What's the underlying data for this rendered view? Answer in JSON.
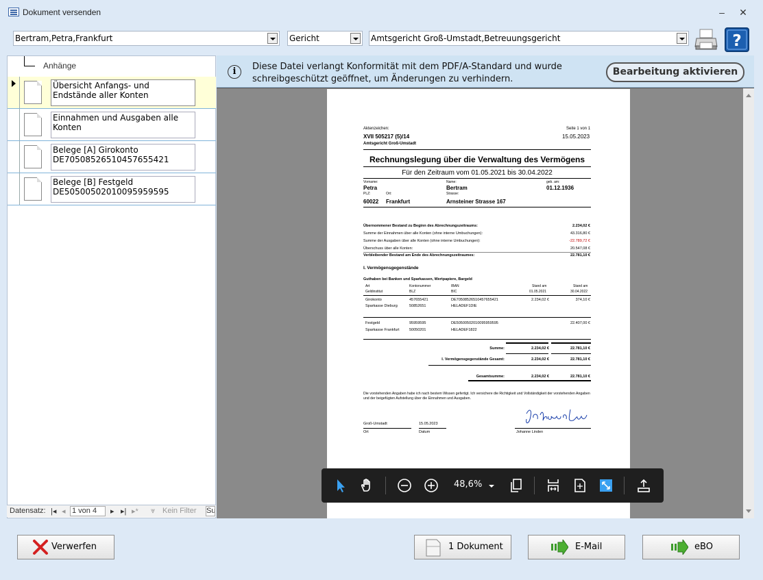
{
  "window": {
    "title": "Dokument versenden",
    "minimize": "–",
    "close": "✕"
  },
  "filters": {
    "person": "Bertram,Petra,Frankfurt",
    "recipient_type": "Gericht",
    "recipient": "Amtsgericht Groß-Umstadt,Betreuungsgericht"
  },
  "tree": {
    "root_label": "Anhänge"
  },
  "attachments": [
    {
      "label": "Übersicht Anfangs- und Endstände aller Konten"
    },
    {
      "label": "Einnahmen und Ausgaben alle Konten"
    },
    {
      "label": "Belege [A] Girokonto DE70508526510457655421"
    },
    {
      "label": "Belege [B] Festgeld DE50500502010095959595"
    }
  ],
  "record_nav": {
    "label": "Datensatz:",
    "position": "1 von 4",
    "filter": "Kein Filter",
    "search": "Su"
  },
  "infobar": {
    "message": "Diese Datei verlangt Konformität mit dem PDF/A-Standard und wurde schreibgeschützt geöffnet, um Änderungen zu verhindern.",
    "button": "Bearbeitung aktivieren"
  },
  "pdf": {
    "az_label": "Aktenzeichen:",
    "az": "XVII 505217 (5)/14",
    "court": "Amtsgericht Groß-Umstadt",
    "page": "Seite 1 von 1",
    "date": "15.05.2023",
    "title": "Rechnungslegung über die Verwaltung des Vermögens",
    "period": "Für den Zeitraum vom 01.05.2021 bis 30.04.2022",
    "vorname_label": "Vorname:",
    "vorname": "Petra",
    "name_label": "Name:",
    "name": "Bertram",
    "geb_label": "geb. am:",
    "geb": "01.12.1936",
    "plz_label": "PLZ:",
    "ort_label": "Ort:",
    "strasse_label": "Strasse:",
    "plz": "60022",
    "ort": "Frankfurt",
    "strasse": "Arnsteiner Strasse 167",
    "summary": [
      {
        "label": "Übernommener Bestand zu Beginn des Abrechnungszeitraums:",
        "value": "2.234,02 €",
        "bold": true
      },
      {
        "label": "Summe der Einnahmen über alle Konten (ohne interne Umbuchungen):",
        "value": "43.316,80 €"
      },
      {
        "label": "Summe der Ausgaben über alle Konten (ohne interne Umbuchungen):",
        "value": "-22.789,72 €",
        "red": true
      },
      {
        "label": "Überschuss über alle Konten:",
        "value": "20.547,08 €"
      },
      {
        "label": "Verbleibender Bestand am Ende des Abrechnungszeitraumes:",
        "value": "22.781,10 €",
        "bold": true
      }
    ],
    "section1": "I. Vermögensgegenstände",
    "subsection": "Guthaben bei Banken und Sparkassen, Wertpapiere, Bargeld",
    "cols": {
      "art": "Art",
      "konto": "Kontonummer",
      "iban": "IBAN",
      "stand1": "Stand am",
      "stand2": "Stand am",
      "institut": "Geldinstitut",
      "blz": "BLZ",
      "bic": "BIC",
      "d1": "01.05.2021",
      "d2": "30.04.2022"
    },
    "accounts": [
      {
        "art": "Girokonto",
        "konto": "457655421",
        "iban": "DE70508526510457655421",
        "v1": "2.234,02 €",
        "v2": "374,10 €",
        "institut": "Sparkasse Dieburg",
        "blz": "50852651",
        "bic": "HELADEF1DIE"
      },
      {
        "art": "Festgeld",
        "konto": "95959595",
        "iban": "DE50500502010095959595",
        "v1": "",
        "v2": "22.407,00 €",
        "institut": "Sparkasse Frankfurt",
        "blz": "50050201",
        "bic": "HELADEF1822"
      }
    ],
    "totals": [
      {
        "label": "Summe:",
        "v1": "2.234,02 €",
        "v2": "22.781,10 €"
      },
      {
        "label": "I. Vermögensgegenstände   Gesamt:",
        "v1": "2.234,02 €",
        "v2": "22.781,10 €"
      },
      {
        "label": "Gesamtsumme:",
        "v1": "2.234,02 €",
        "v2": "22.781,10 €"
      }
    ],
    "declaration": "Die vorstehenden Angaben habe ich nach bestem Wissen gefertigt. Ich versichere die Richtigkeit und Vollständigkeit der vorstehenden Angaben und der beigefügten Aufstellung über die Einnahmen und Ausgaben.",
    "sig_place": "Groß-Umstadt",
    "sig_date": "15.05.2023",
    "sig_ort_label": "Ort",
    "sig_datum_label": "Datum",
    "sig_name": "Johanne Linden"
  },
  "viewer_toolbar": {
    "zoom": "48,6%"
  },
  "buttons": {
    "discard": "Verwerfen",
    "documents": "1 Dokument",
    "email": "E-Mail",
    "ebo": "eBO"
  }
}
